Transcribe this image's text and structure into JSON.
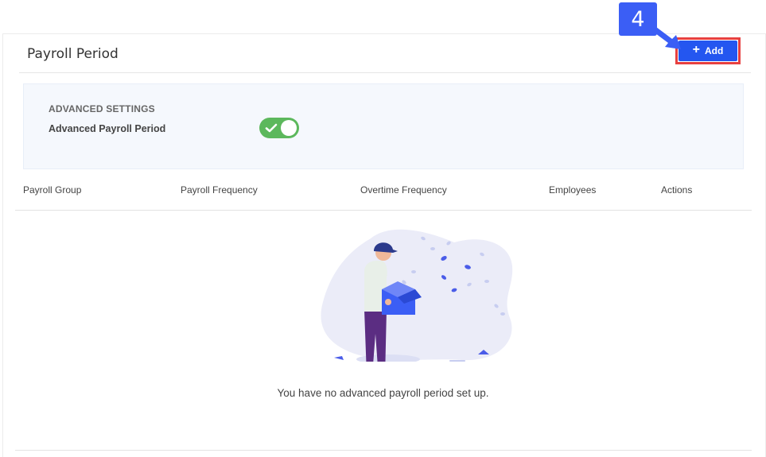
{
  "header": {
    "title": "Payroll Period",
    "add_label": "Add",
    "add_icon": "plus-icon"
  },
  "settings": {
    "section_title": "ADVANCED SETTINGS",
    "toggle_label": "Advanced Payroll Period",
    "toggle_on": true,
    "toggle_color": "#5cb85c"
  },
  "table": {
    "columns": [
      "Payroll Group",
      "Payroll Frequency",
      "Overtime Frequency",
      "Employees",
      "Actions"
    ]
  },
  "empty_state": {
    "message": "You have no advanced payroll period set up."
  },
  "annotation": {
    "step_number": "4",
    "color": "#3b5ef5",
    "highlight_color": "#e74040"
  },
  "colors": {
    "primary": "#2456f0",
    "settings_bg": "#f5f8fd"
  }
}
